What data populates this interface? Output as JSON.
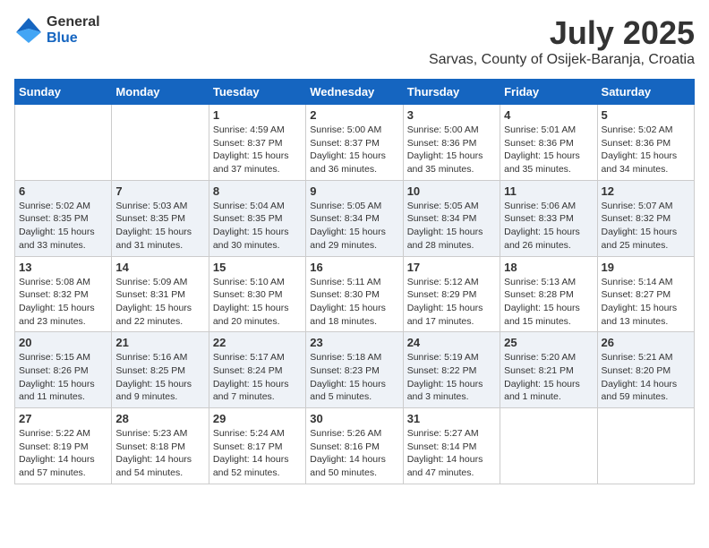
{
  "header": {
    "logo_general": "General",
    "logo_blue": "Blue",
    "month_title": "July 2025",
    "location": "Sarvas, County of Osijek-Baranja, Croatia"
  },
  "weekdays": [
    "Sunday",
    "Monday",
    "Tuesday",
    "Wednesday",
    "Thursday",
    "Friday",
    "Saturday"
  ],
  "weeks": [
    [
      {
        "day": "",
        "info": ""
      },
      {
        "day": "",
        "info": ""
      },
      {
        "day": "1",
        "info": "Sunrise: 4:59 AM\nSunset: 8:37 PM\nDaylight: 15 hours\nand 37 minutes."
      },
      {
        "day": "2",
        "info": "Sunrise: 5:00 AM\nSunset: 8:37 PM\nDaylight: 15 hours\nand 36 minutes."
      },
      {
        "day": "3",
        "info": "Sunrise: 5:00 AM\nSunset: 8:36 PM\nDaylight: 15 hours\nand 35 minutes."
      },
      {
        "day": "4",
        "info": "Sunrise: 5:01 AM\nSunset: 8:36 PM\nDaylight: 15 hours\nand 35 minutes."
      },
      {
        "day": "5",
        "info": "Sunrise: 5:02 AM\nSunset: 8:36 PM\nDaylight: 15 hours\nand 34 minutes."
      }
    ],
    [
      {
        "day": "6",
        "info": "Sunrise: 5:02 AM\nSunset: 8:35 PM\nDaylight: 15 hours\nand 33 minutes."
      },
      {
        "day": "7",
        "info": "Sunrise: 5:03 AM\nSunset: 8:35 PM\nDaylight: 15 hours\nand 31 minutes."
      },
      {
        "day": "8",
        "info": "Sunrise: 5:04 AM\nSunset: 8:35 PM\nDaylight: 15 hours\nand 30 minutes."
      },
      {
        "day": "9",
        "info": "Sunrise: 5:05 AM\nSunset: 8:34 PM\nDaylight: 15 hours\nand 29 minutes."
      },
      {
        "day": "10",
        "info": "Sunrise: 5:05 AM\nSunset: 8:34 PM\nDaylight: 15 hours\nand 28 minutes."
      },
      {
        "day": "11",
        "info": "Sunrise: 5:06 AM\nSunset: 8:33 PM\nDaylight: 15 hours\nand 26 minutes."
      },
      {
        "day": "12",
        "info": "Sunrise: 5:07 AM\nSunset: 8:32 PM\nDaylight: 15 hours\nand 25 minutes."
      }
    ],
    [
      {
        "day": "13",
        "info": "Sunrise: 5:08 AM\nSunset: 8:32 PM\nDaylight: 15 hours\nand 23 minutes."
      },
      {
        "day": "14",
        "info": "Sunrise: 5:09 AM\nSunset: 8:31 PM\nDaylight: 15 hours\nand 22 minutes."
      },
      {
        "day": "15",
        "info": "Sunrise: 5:10 AM\nSunset: 8:30 PM\nDaylight: 15 hours\nand 20 minutes."
      },
      {
        "day": "16",
        "info": "Sunrise: 5:11 AM\nSunset: 8:30 PM\nDaylight: 15 hours\nand 18 minutes."
      },
      {
        "day": "17",
        "info": "Sunrise: 5:12 AM\nSunset: 8:29 PM\nDaylight: 15 hours\nand 17 minutes."
      },
      {
        "day": "18",
        "info": "Sunrise: 5:13 AM\nSunset: 8:28 PM\nDaylight: 15 hours\nand 15 minutes."
      },
      {
        "day": "19",
        "info": "Sunrise: 5:14 AM\nSunset: 8:27 PM\nDaylight: 15 hours\nand 13 minutes."
      }
    ],
    [
      {
        "day": "20",
        "info": "Sunrise: 5:15 AM\nSunset: 8:26 PM\nDaylight: 15 hours\nand 11 minutes."
      },
      {
        "day": "21",
        "info": "Sunrise: 5:16 AM\nSunset: 8:25 PM\nDaylight: 15 hours\nand 9 minutes."
      },
      {
        "day": "22",
        "info": "Sunrise: 5:17 AM\nSunset: 8:24 PM\nDaylight: 15 hours\nand 7 minutes."
      },
      {
        "day": "23",
        "info": "Sunrise: 5:18 AM\nSunset: 8:23 PM\nDaylight: 15 hours\nand 5 minutes."
      },
      {
        "day": "24",
        "info": "Sunrise: 5:19 AM\nSunset: 8:22 PM\nDaylight: 15 hours\nand 3 minutes."
      },
      {
        "day": "25",
        "info": "Sunrise: 5:20 AM\nSunset: 8:21 PM\nDaylight: 15 hours\nand 1 minute."
      },
      {
        "day": "26",
        "info": "Sunrise: 5:21 AM\nSunset: 8:20 PM\nDaylight: 14 hours\nand 59 minutes."
      }
    ],
    [
      {
        "day": "27",
        "info": "Sunrise: 5:22 AM\nSunset: 8:19 PM\nDaylight: 14 hours\nand 57 minutes."
      },
      {
        "day": "28",
        "info": "Sunrise: 5:23 AM\nSunset: 8:18 PM\nDaylight: 14 hours\nand 54 minutes."
      },
      {
        "day": "29",
        "info": "Sunrise: 5:24 AM\nSunset: 8:17 PM\nDaylight: 14 hours\nand 52 minutes."
      },
      {
        "day": "30",
        "info": "Sunrise: 5:26 AM\nSunset: 8:16 PM\nDaylight: 14 hours\nand 50 minutes."
      },
      {
        "day": "31",
        "info": "Sunrise: 5:27 AM\nSunset: 8:14 PM\nDaylight: 14 hours\nand 47 minutes."
      },
      {
        "day": "",
        "info": ""
      },
      {
        "day": "",
        "info": ""
      }
    ]
  ]
}
